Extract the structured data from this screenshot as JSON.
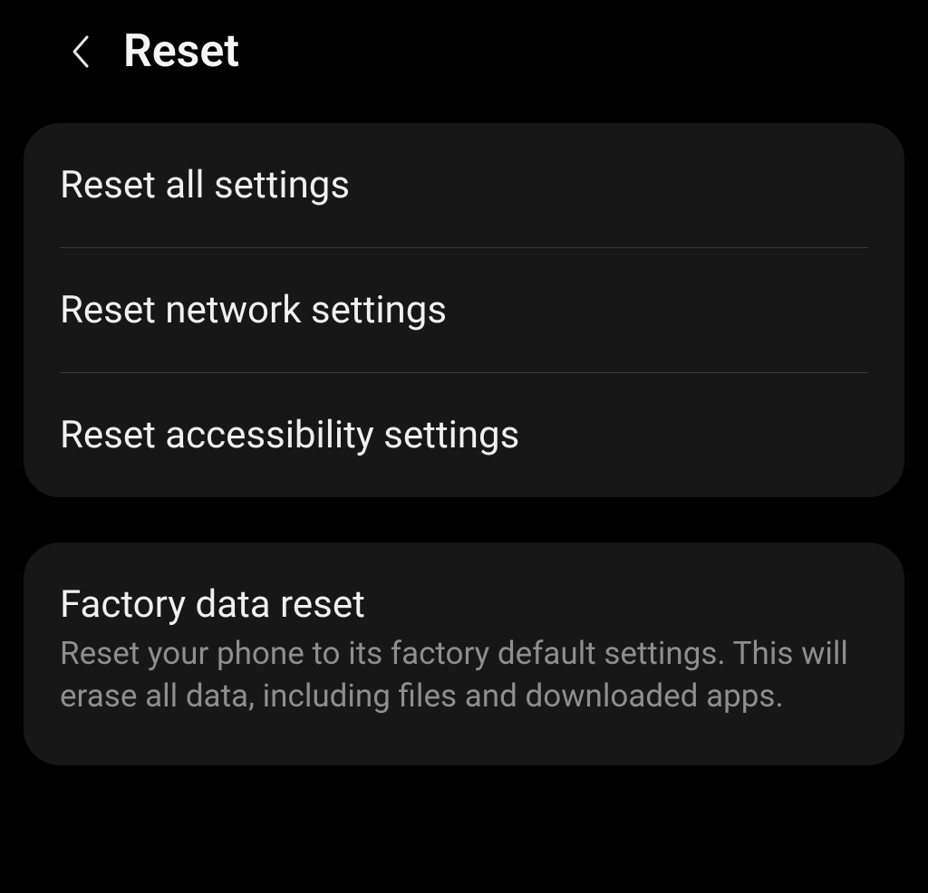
{
  "header": {
    "title": "Reset"
  },
  "card1": {
    "items": [
      {
        "title": "Reset all settings"
      },
      {
        "title": "Reset network settings"
      },
      {
        "title": "Reset accessibility settings"
      }
    ]
  },
  "card2": {
    "item": {
      "title": "Factory data reset",
      "description": "Reset your phone to its factory default settings. This will erase all data, including files and downloaded apps."
    }
  }
}
